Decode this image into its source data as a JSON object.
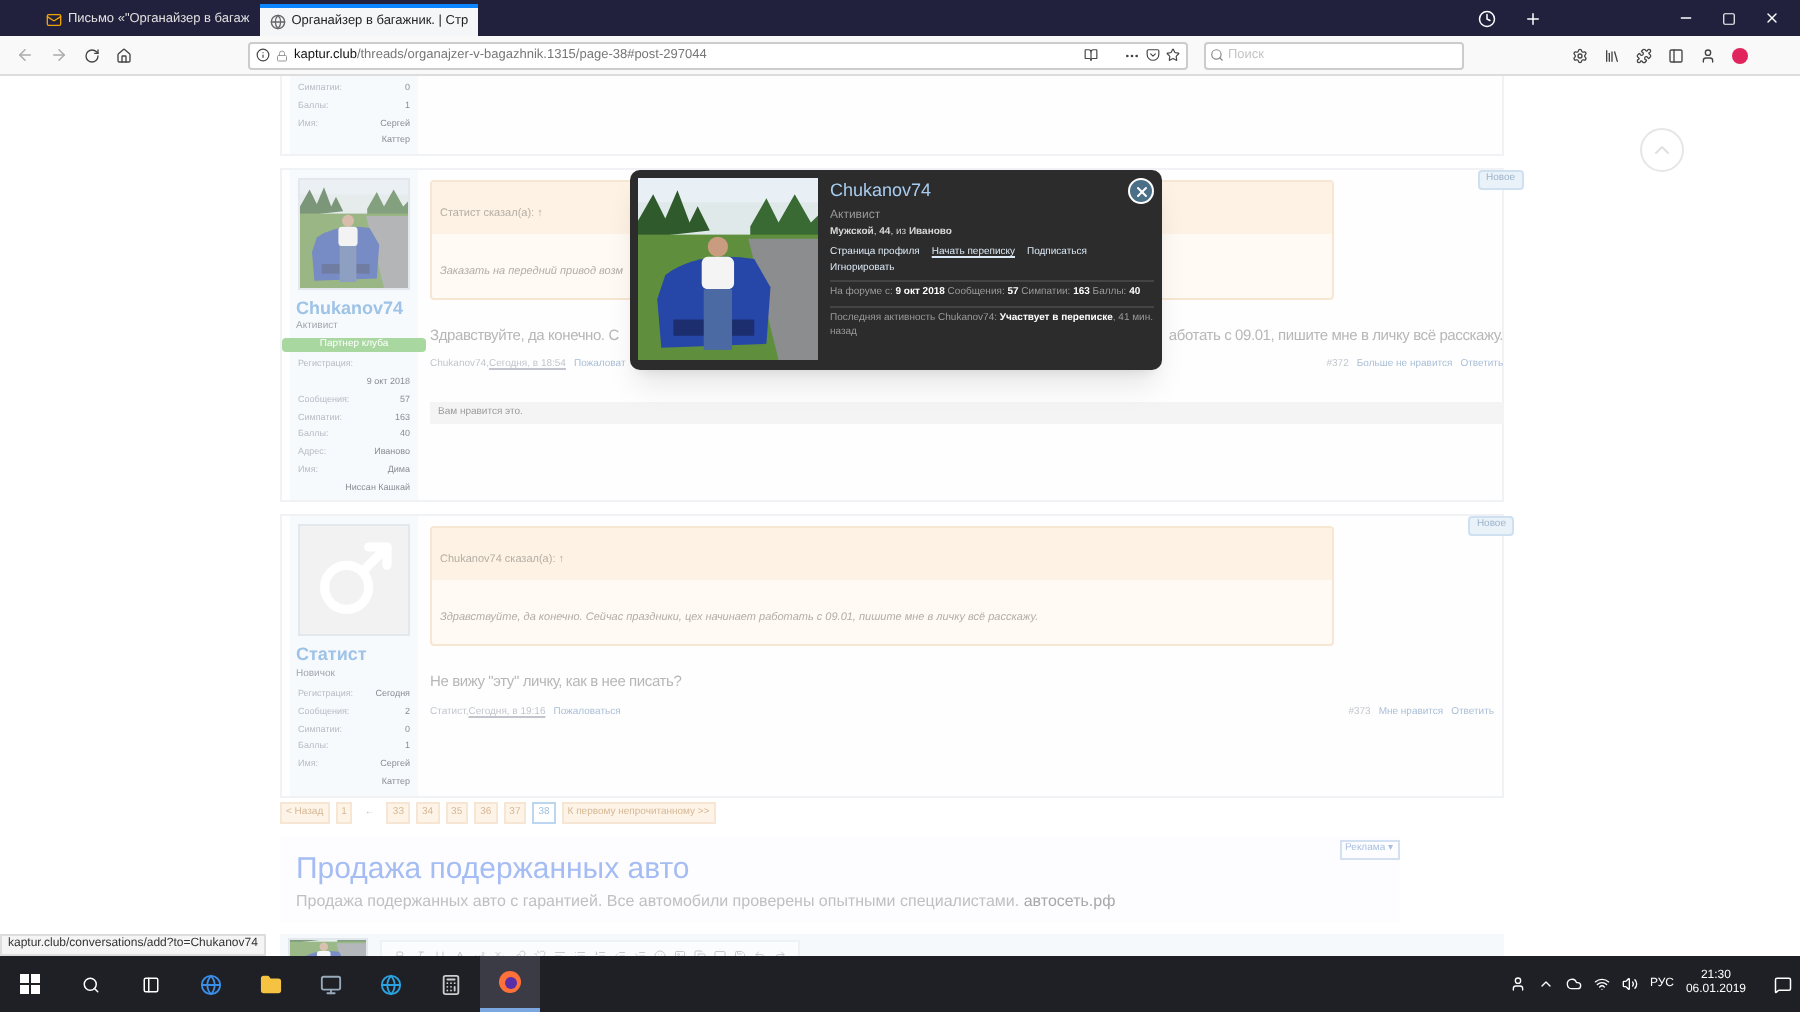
{
  "browser": {
    "tabs": [
      {
        "title": "Письмо «\"Органайзер в багаж",
        "kind": "mail",
        "selected": false
      },
      {
        "title": "Органайзер в багажник. | Стр",
        "kind": "site",
        "selected": true
      }
    ],
    "url_host": "kaptur.club",
    "url_path": "/threads/organajzer-v-bagazhnik.1315/page-38#post-297044",
    "search": {
      "placeholder": "Поиск"
    }
  },
  "posts": [
    {
      "kind": "tail",
      "stats": [
        {
          "label": "Симпатии:",
          "value": "0"
        },
        {
          "label": "Баллы:",
          "value": "1"
        },
        {
          "label": "Имя:",
          "value": "Сергей"
        },
        {
          "value": "Каттер"
        }
      ]
    },
    {
      "kind": "photo-avatar",
      "name": "Chukanov74",
      "title": "Активист",
      "badge": "Партнер клуба",
      "new_label": "Новое",
      "stats": [
        {
          "label": "Регистрация:"
        },
        {
          "value": "9 окт 2018"
        },
        {
          "label": "Сообщения:",
          "value": "57"
        },
        {
          "label": "Симпатии:",
          "value": "163"
        },
        {
          "label": "Баллы:",
          "value": "40"
        },
        {
          "label": "Адрес:",
          "value": "Иваново"
        },
        {
          "label": "Имя:",
          "value": "Дима"
        },
        {
          "value": "Ниссан Кашкай"
        }
      ],
      "quote": {
        "author": "Статист сказал(а): ↑",
        "text": "Заказать на передний привод возм"
      },
      "message": [
        "Здравствуйте, да конечно. С",
        "аботать с 09.01, пишите мне в личку всё расскажу."
      ],
      "meta": {
        "author": "Chukanov74, ",
        "date": "Сегодня, в 18:54",
        "report": "Пожаловат",
        "number": "#372",
        "like": "Больше не нравится",
        "reply": "Ответить"
      },
      "likes": "Вам нравится это."
    },
    {
      "kind": "default-avatar",
      "name": "Статист",
      "title": "Новичок",
      "new_label": "Новое",
      "stats": [
        {
          "label": "Регистрация:",
          "value": "Сегодня"
        },
        {
          "label": "Сообщения:",
          "value": "2"
        },
        {
          "label": "Симпатии:",
          "value": "0"
        },
        {
          "label": "Баллы:",
          "value": "1"
        },
        {
          "label": "Имя:",
          "value": "Сергей"
        },
        {
          "value": "Каттер"
        }
      ],
      "quote": {
        "author": "Chukanov74 сказал(а): ↑",
        "text": "Здравствуйте, да конечно. Сейчас праздники, цех начинает работать с 09.01, пишите мне в личку всё расскажу."
      },
      "message": [
        "Не вижу \"эту\" личку, как в нее писать?"
      ],
      "meta": {
        "author": "Статист, ",
        "date": "Сегодня, в 19:16",
        "report": "Пожаловаться",
        "number": "#373",
        "like": "Мне нравится",
        "reply": "Ответить"
      }
    }
  ],
  "popup": {
    "name": "Chukanov74",
    "title": "Активист",
    "info": "**Мужской**, **44**, из **Иваново**",
    "links": [
      "Страница профиля",
      "Начать переписку",
      "Подписаться",
      "Игнорировать"
    ],
    "stats": "На форуме с: **9 окт 2018**  Сообщения: **57**  Симпатии: **163**  Баллы: **40**",
    "activity": "Последняя активность Chukanov74: **Участвует в переписке**, 41 мин. назад"
  },
  "pagination": {
    "prev": "< Назад",
    "pages": [
      {
        "label": "1",
        "selected": false
      },
      {
        "label": "←",
        "kind": "gap",
        "selected": false
      },
      {
        "label": "33",
        "selected": false
      },
      {
        "label": "34",
        "selected": false
      },
      {
        "label": "35",
        "selected": false
      },
      {
        "label": "36",
        "selected": false
      },
      {
        "label": "37",
        "selected": false
      },
      {
        "label": "38",
        "selected": true
      }
    ],
    "next": "К первому непрочитанному >>"
  },
  "ad": {
    "label": "Реклама ▾",
    "title": "Продажа подержанных авто",
    "text": "Продажа подержанных авто с гарантией. Все автомобили проверены опытными специалистами.",
    "domain": "автосеть.рф"
  },
  "status_link": "kaptur.club/conversations/add?to=Chukanov74",
  "taskbar": {
    "language": "РУС",
    "time": "21:30",
    "date": "06.01.2019"
  }
}
